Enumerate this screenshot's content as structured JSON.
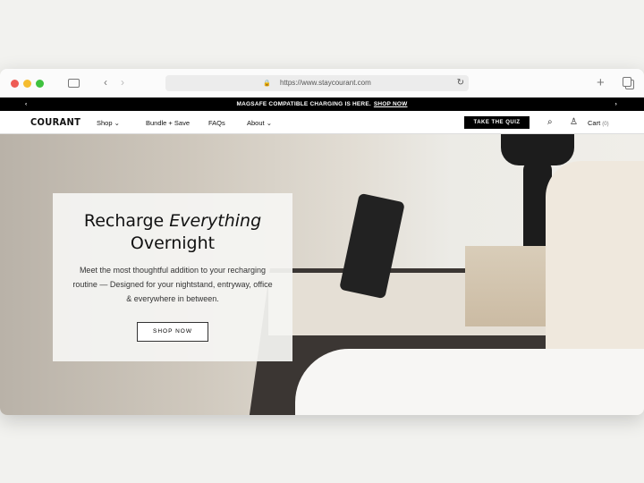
{
  "browser": {
    "url": "https://www.staycourant.com",
    "colors": {
      "close": "#ee5c55",
      "minimize": "#f5bd30",
      "maximize": "#3fc23f"
    }
  },
  "promo": {
    "text": "MAGSAFE COMPATIBLE CHARGING IS HERE.",
    "link": "SHOP NOW"
  },
  "nav": {
    "logo": "COURANT",
    "items": [
      "Shop",
      "Bundle + Save",
      "FAQs",
      "About"
    ],
    "quiz": "TAKE THE QUIZ",
    "cart": "Cart",
    "cart_count": "(0)"
  },
  "hero": {
    "title_a": "Recharge ",
    "title_em": "Everything",
    "title_b": "Overnight",
    "body": "Meet the most thoughtful addition to your recharging routine — Designed for your nightstand, entryway, office & everywhere in between.",
    "cta": "SHOP NOW"
  }
}
